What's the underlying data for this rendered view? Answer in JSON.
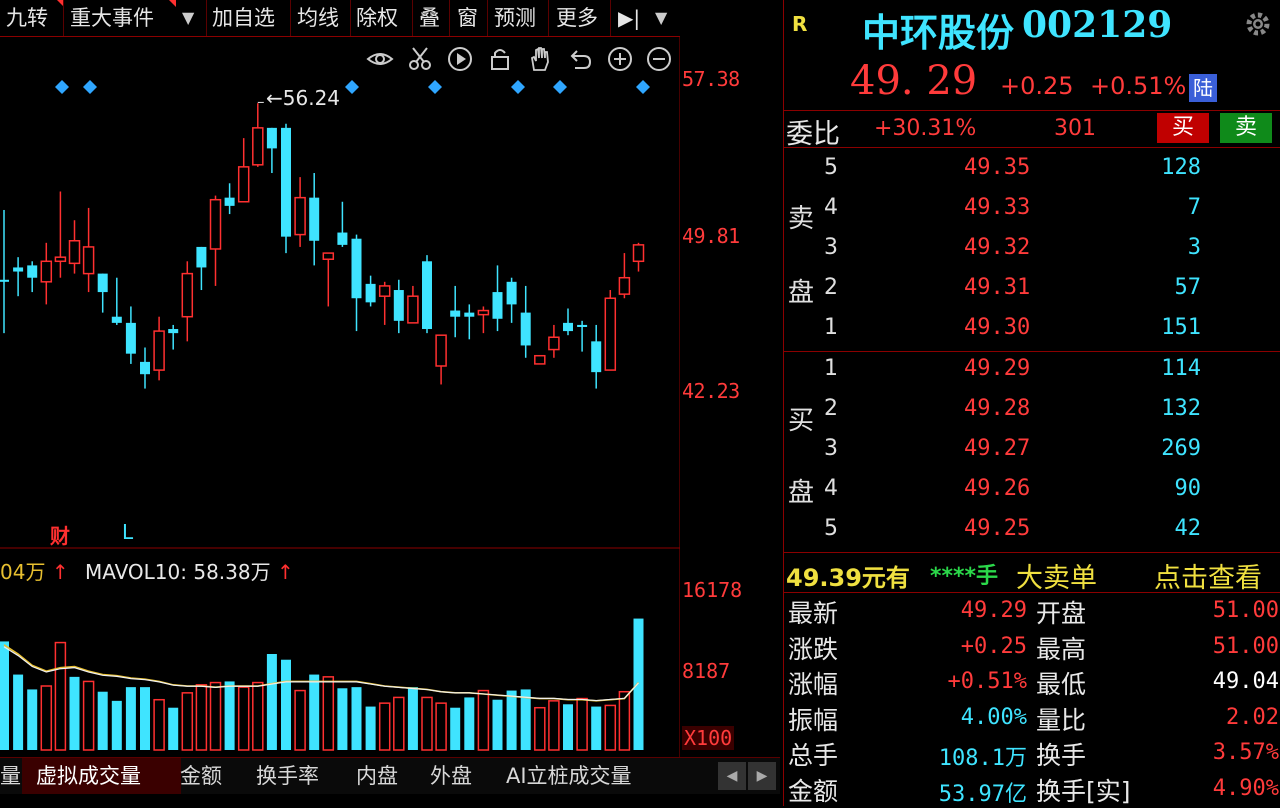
{
  "toolbar": {
    "items": [
      "九转",
      "重大事件",
      "加自选",
      "均线",
      "除权",
      "叠",
      "窗",
      "预测",
      "更多"
    ]
  },
  "chart": {
    "price_labels": [
      "57.38",
      "49.81",
      "42.23"
    ],
    "peak_label": "←56.24",
    "markers": {
      "cai": "财",
      "l": "L"
    },
    "vol_indicator_prefix": "04万",
    "vol_indicator_label": "MAVOL10: 58.38万",
    "vol_labels": [
      "16178",
      "8187",
      "X100"
    ],
    "colors": {
      "up": "#ff3030",
      "down": "#3fe4ff",
      "ma": "#e8c030",
      "ma2": "#f0f0f0"
    }
  },
  "chart_data": {
    "type": "candlestick",
    "ylim": [
      42.23,
      57.38
    ],
    "peak": 56.24,
    "candles": [
      [
        47.5,
        47.6,
        51.0,
        45.0,
        "d"
      ],
      [
        48.0,
        48.2,
        48.7,
        46.8,
        "d"
      ],
      [
        48.3,
        47.7,
        48.5,
        47.0,
        "d"
      ],
      [
        47.5,
        48.5,
        49.4,
        46.4,
        "u"
      ],
      [
        48.7,
        48.5,
        51.9,
        47.7,
        "u"
      ],
      [
        48.4,
        49.5,
        50.5,
        47.9,
        "u"
      ],
      [
        49.2,
        47.9,
        51.1,
        47.0,
        "u"
      ],
      [
        47.0,
        47.9,
        47.6,
        46.0,
        "d"
      ],
      [
        45.8,
        45.5,
        47.7,
        45.4,
        "d"
      ],
      [
        45.5,
        44.0,
        46.3,
        43.5,
        "d"
      ],
      [
        43.6,
        43.0,
        44.3,
        42.3,
        "d"
      ],
      [
        43.2,
        45.1,
        45.8,
        42.7,
        "u"
      ],
      [
        45.2,
        45.0,
        45.4,
        44.2,
        "d"
      ],
      [
        45.8,
        47.9,
        48.5,
        44.6,
        "u"
      ],
      [
        48.2,
        49.2,
        49.2,
        47.1,
        "d"
      ],
      [
        49.1,
        51.5,
        51.7,
        47.3,
        "u"
      ],
      [
        51.6,
        51.2,
        52.3,
        50.8,
        "d"
      ],
      [
        51.4,
        53.1,
        54.5,
        51.4,
        "u"
      ],
      [
        53.2,
        55.0,
        56.2,
        53.1,
        "u"
      ],
      [
        55.0,
        54.0,
        54.7,
        52.8,
        "d"
      ],
      [
        55.0,
        49.7,
        55.2,
        48.9,
        "d"
      ],
      [
        49.8,
        51.6,
        52.6,
        49.2,
        "u"
      ],
      [
        51.6,
        49.5,
        52.8,
        48.3,
        "d"
      ],
      [
        48.6,
        48.9,
        48.4,
        46.3,
        "u"
      ],
      [
        49.9,
        49.3,
        51.4,
        49.2,
        "d"
      ],
      [
        49.6,
        46.7,
        49.8,
        45.1,
        "d"
      ],
      [
        47.4,
        46.5,
        47.8,
        46.3,
        "d"
      ],
      [
        46.8,
        47.3,
        47.5,
        45.4,
        "u"
      ],
      [
        47.1,
        45.6,
        47.6,
        45.0,
        "d"
      ],
      [
        45.5,
        46.8,
        47.3,
        46.8,
        "u"
      ],
      [
        48.5,
        45.2,
        48.8,
        45.0,
        "d"
      ],
      [
        43.4,
        44.9,
        43.6,
        42.5,
        "u"
      ],
      [
        46.1,
        45.8,
        47.3,
        44.8,
        "d"
      ],
      [
        46.0,
        45.8,
        46.4,
        44.7,
        "d"
      ],
      [
        45.9,
        46.1,
        46.3,
        45.0,
        "u"
      ],
      [
        47.0,
        45.7,
        48.3,
        45.1,
        "d"
      ],
      [
        47.5,
        46.4,
        47.7,
        45.5,
        "d"
      ],
      [
        46.0,
        44.4,
        47.3,
        43.8,
        "d"
      ],
      [
        43.5,
        43.9,
        43.9,
        43.8,
        "u"
      ],
      [
        44.8,
        44.2,
        45.4,
        43.8,
        "u"
      ],
      [
        45.1,
        45.5,
        46.2,
        44.9,
        "d"
      ],
      [
        45.4,
        45.3,
        45.6,
        44.1,
        "d"
      ],
      [
        44.6,
        43.1,
        45.4,
        42.3,
        "d"
      ],
      [
        43.2,
        46.7,
        47.1,
        43.2,
        "u"
      ],
      [
        46.9,
        47.7,
        48.9,
        46.7,
        "u"
      ],
      [
        48.5,
        49.3,
        49.4,
        48.0,
        "u"
      ]
    ],
    "volume": [
      [
        9.5,
        "d"
      ],
      [
        6.6,
        "d"
      ],
      [
        5.3,
        "d"
      ],
      [
        5.6,
        "u"
      ],
      [
        9.4,
        "u"
      ],
      [
        6.4,
        "d"
      ],
      [
        6.0,
        "u"
      ],
      [
        5.1,
        "d"
      ],
      [
        4.3,
        "d"
      ],
      [
        5.5,
        "d"
      ],
      [
        5.5,
        "d"
      ],
      [
        4.4,
        "u"
      ],
      [
        3.7,
        "d"
      ],
      [
        5.0,
        "u"
      ],
      [
        5.7,
        "u"
      ],
      [
        5.9,
        "u"
      ],
      [
        6.0,
        "d"
      ],
      [
        5.5,
        "u"
      ],
      [
        5.9,
        "u"
      ],
      [
        8.4,
        "d"
      ],
      [
        7.9,
        "d"
      ],
      [
        5.2,
        "u"
      ],
      [
        6.6,
        "d"
      ],
      [
        6.4,
        "u"
      ],
      [
        5.4,
        "d"
      ],
      [
        5.5,
        "d"
      ],
      [
        3.8,
        "d"
      ],
      [
        4.1,
        "u"
      ],
      [
        4.6,
        "u"
      ],
      [
        5.5,
        "d"
      ],
      [
        4.6,
        "u"
      ],
      [
        4.1,
        "u"
      ],
      [
        3.7,
        "d"
      ],
      [
        4.6,
        "d"
      ],
      [
        5.2,
        "u"
      ],
      [
        4.4,
        "d"
      ],
      [
        5.2,
        "d"
      ],
      [
        5.3,
        "d"
      ],
      [
        3.7,
        "u"
      ],
      [
        4.3,
        "u"
      ],
      [
        4.0,
        "d"
      ],
      [
        4.5,
        "u"
      ],
      [
        3.8,
        "d"
      ],
      [
        3.9,
        "u"
      ],
      [
        5.1,
        "u"
      ],
      [
        11.5,
        "d"
      ]
    ],
    "ma": [
      9.2,
      8.4,
      7.4,
      6.9,
      7.2,
      7.3,
      6.9,
      6.6,
      6.5,
      6.3,
      6.2,
      6.0,
      5.7,
      5.6,
      5.6,
      5.5,
      5.6,
      5.6,
      5.6,
      5.8,
      6.0,
      6.0,
      6.0,
      6.0,
      6.0,
      6.0,
      5.8,
      5.6,
      5.5,
      5.4,
      5.3,
      5.1,
      5.0,
      5.0,
      4.9,
      4.8,
      4.7,
      4.6,
      4.5,
      4.5,
      4.4,
      4.4,
      4.3,
      4.4,
      4.5,
      5.9
    ],
    "vol_ylim": [
      0,
      16178
    ]
  },
  "bottom_tabs": [
    "量",
    "虚拟成交量",
    "金额",
    "换手率",
    "内盘",
    "外盘",
    "AI立桩成交量"
  ],
  "right_panel": {
    "badge": "R",
    "stock_name": "中环股份",
    "stock_code": "002129",
    "price": "49. 29",
    "change": "+0.25",
    "change_pct": "+0.51%",
    "lu_badge": "陆",
    "weibi_label": "委比",
    "weibi_val": "+30.31%",
    "weicha_val": "301",
    "buy_button": "买",
    "sell_button": "卖",
    "sell_side_label": [
      "卖",
      "盘"
    ],
    "buy_side_label": [
      "买",
      "盘"
    ],
    "sell_levels": [
      {
        "lvl": "5",
        "price": "49.35",
        "qty": "128"
      },
      {
        "lvl": "4",
        "price": "49.33",
        "qty": "7"
      },
      {
        "lvl": "3",
        "price": "49.32",
        "qty": "3"
      },
      {
        "lvl": "2",
        "price": "49.31",
        "qty": "57"
      },
      {
        "lvl": "1",
        "price": "49.30",
        "qty": "151"
      }
    ],
    "buy_levels": [
      {
        "lvl": "1",
        "price": "49.29",
        "qty": "114"
      },
      {
        "lvl": "2",
        "price": "49.28",
        "qty": "132"
      },
      {
        "lvl": "3",
        "price": "49.27",
        "qty": "269"
      },
      {
        "lvl": "4",
        "price": "49.26",
        "qty": "90"
      },
      {
        "lvl": "5",
        "price": "49.25",
        "qty": "42"
      }
    ],
    "big_order": {
      "price": "49.39元有",
      "stars": "****手",
      "text": "大卖单",
      "link": "点击查看"
    },
    "stats_left": [
      {
        "label": "最新",
        "value": "49.29",
        "color": "#ff3b3b"
      },
      {
        "label": "涨跌",
        "value": "+0.25",
        "color": "#ff3b3b"
      },
      {
        "label": "涨幅",
        "value": "+0.51%",
        "color": "#ff3b3b"
      },
      {
        "label": "振幅",
        "value": "4.00%",
        "color": "#3fe4ff"
      },
      {
        "label": "总手",
        "value": "108.1万",
        "color": "#3fe4ff"
      },
      {
        "label": "金额",
        "value": "53.97亿",
        "color": "#3fe4ff"
      }
    ],
    "stats_right": [
      {
        "label": "开盘",
        "value": "51.00",
        "color": "#ff3b3b"
      },
      {
        "label": "最高",
        "value": "51.00",
        "color": "#ff3b3b"
      },
      {
        "label": "最低",
        "value": "49.04",
        "color": "#ffffff"
      },
      {
        "label": "量比",
        "value": "2.02",
        "color": "#ff3b3b"
      },
      {
        "label": "换手",
        "value": "3.57%",
        "color": "#ff3b3b"
      },
      {
        "label": "换手[实]",
        "value": "4.90%",
        "color": "#ff3b3b"
      }
    ]
  }
}
